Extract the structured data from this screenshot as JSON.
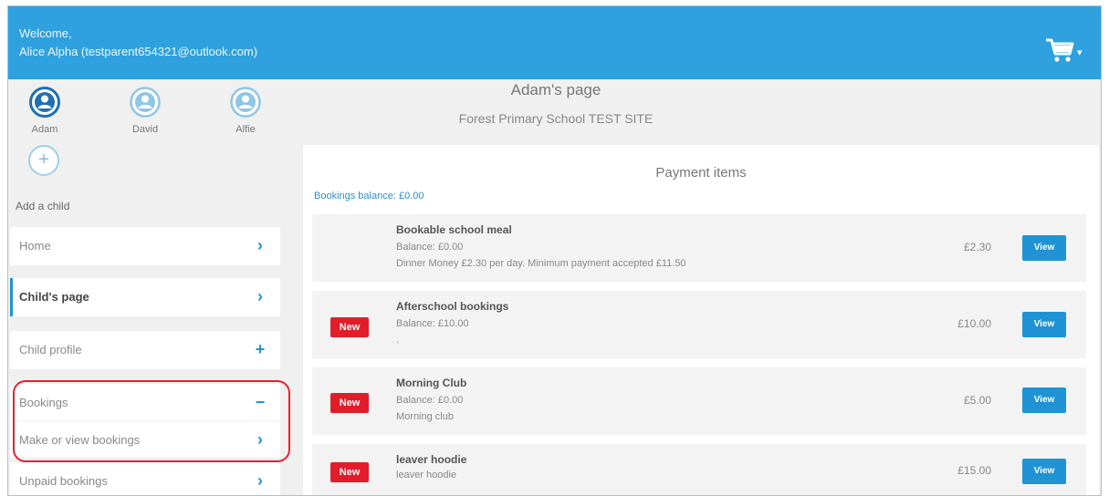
{
  "header": {
    "welcome_line1": "Welcome,",
    "welcome_line2": "Alice Alpha (testparent654321@outlook.com)",
    "cart_icon": "cart-icon",
    "cart_dropdown": "▾"
  },
  "children": [
    {
      "name": "Adam",
      "selected": true
    },
    {
      "name": "David",
      "selected": false
    },
    {
      "name": "Alfie",
      "selected": false
    }
  ],
  "add_child": {
    "label": "Add a child",
    "icon": "+"
  },
  "nav": {
    "home": {
      "label": "Home",
      "icon": "›"
    },
    "childs_page": {
      "label": "Child's page",
      "icon": "›"
    },
    "child_profile": {
      "label": "Child profile",
      "icon": "+"
    },
    "bookings": {
      "label": "Bookings",
      "icon": "−"
    },
    "make_view_bookings": {
      "label": "Make or view bookings",
      "icon": "›"
    },
    "unpaid_bookings": {
      "label": "Unpaid bookings",
      "icon": "›"
    }
  },
  "main": {
    "title": "Adam's page",
    "school": "Forest Primary School TEST SITE",
    "panel_title": "Payment items",
    "bookings_balance": "Bookings balance: £0.00",
    "items": [
      {
        "title": "Bookable school meal",
        "line1": "Balance: £0.00",
        "line2": "Dinner Money £2.30 per day. Minimum payment accepted £11.50",
        "badge": "",
        "price": "£2.30",
        "button": "View"
      },
      {
        "title": "Afterschool bookings",
        "line1": "Balance: £10.00",
        "line2": ".",
        "badge": "New",
        "price": "£10.00",
        "button": "View"
      },
      {
        "title": "Morning Club",
        "line1": "Balance: £0.00",
        "line2": "Morning club",
        "badge": "New",
        "price": "£5.00",
        "button": "View"
      },
      {
        "title": "leaver hoodie",
        "line1": "leaver hoodie",
        "line2": "",
        "badge": "New",
        "price": "£15.00",
        "button": "View"
      }
    ]
  },
  "colors": {
    "brand_blue": "#2ea1de",
    "button_blue": "#1f93d3",
    "badge_red": "#e21d2a",
    "highlight_red": "#e2232d"
  }
}
